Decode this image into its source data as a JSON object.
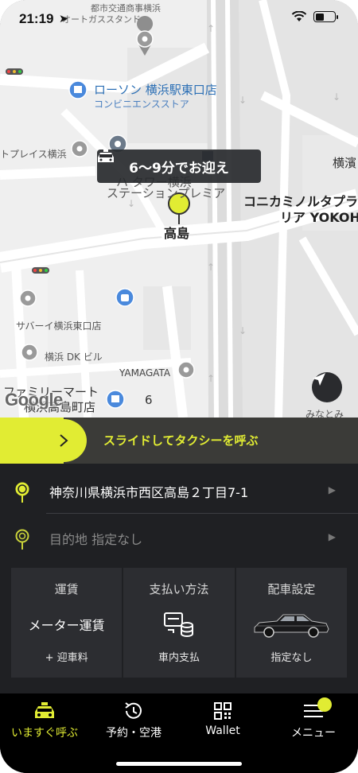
{
  "status_bar": {
    "time": "21:19"
  },
  "map": {
    "labels": {
      "top1": "都市交通商事横浜",
      "top2": "オートガススタンド",
      "lawson": "ローソン 横浜駅東口店",
      "lawson_sub": "コンビニエンスストア",
      "place_left": "トプレイス横浜",
      "yokohama": "横濱",
      "station": "ステーションプレミア",
      "tower": "ハ タワー横浜",
      "konica1": "コニカミノルタプラネ",
      "konica2": "リア YOKOHAM",
      "takashima": "高島",
      "subway": "サバーイ横浜東口店",
      "dk": "横浜 DK ビル",
      "yamagata": "YAMAGATA",
      "familymart1": "ファミリーマート",
      "familymart2": "横浜高島町店",
      "num6": "6",
      "minato": "みなとみ"
    },
    "eta_text": "6～9分でお迎え",
    "google": "Google"
  },
  "slide": {
    "label": "スライドしてタクシーを呼ぶ"
  },
  "pickup": {
    "address": "神奈川県横浜市西区高島２丁目7-1"
  },
  "destination": {
    "placeholder": "目的地 指定なし"
  },
  "options": [
    {
      "header": "運賃",
      "value": "メーター運賃",
      "sub": "+ 迎車料"
    },
    {
      "header": "支払い方法",
      "value": "",
      "sub": "車内支払"
    },
    {
      "header": "配車設定",
      "value": "",
      "sub": "指定なし"
    }
  ],
  "tabs": [
    {
      "label": "いますぐ呼ぶ"
    },
    {
      "label": "予約・空港"
    },
    {
      "label": "Wallet"
    },
    {
      "label": "メニュー"
    }
  ],
  "colors": {
    "accent": "#e1ec33",
    "panel": "#1f2023",
    "card": "#2c2d31"
  }
}
